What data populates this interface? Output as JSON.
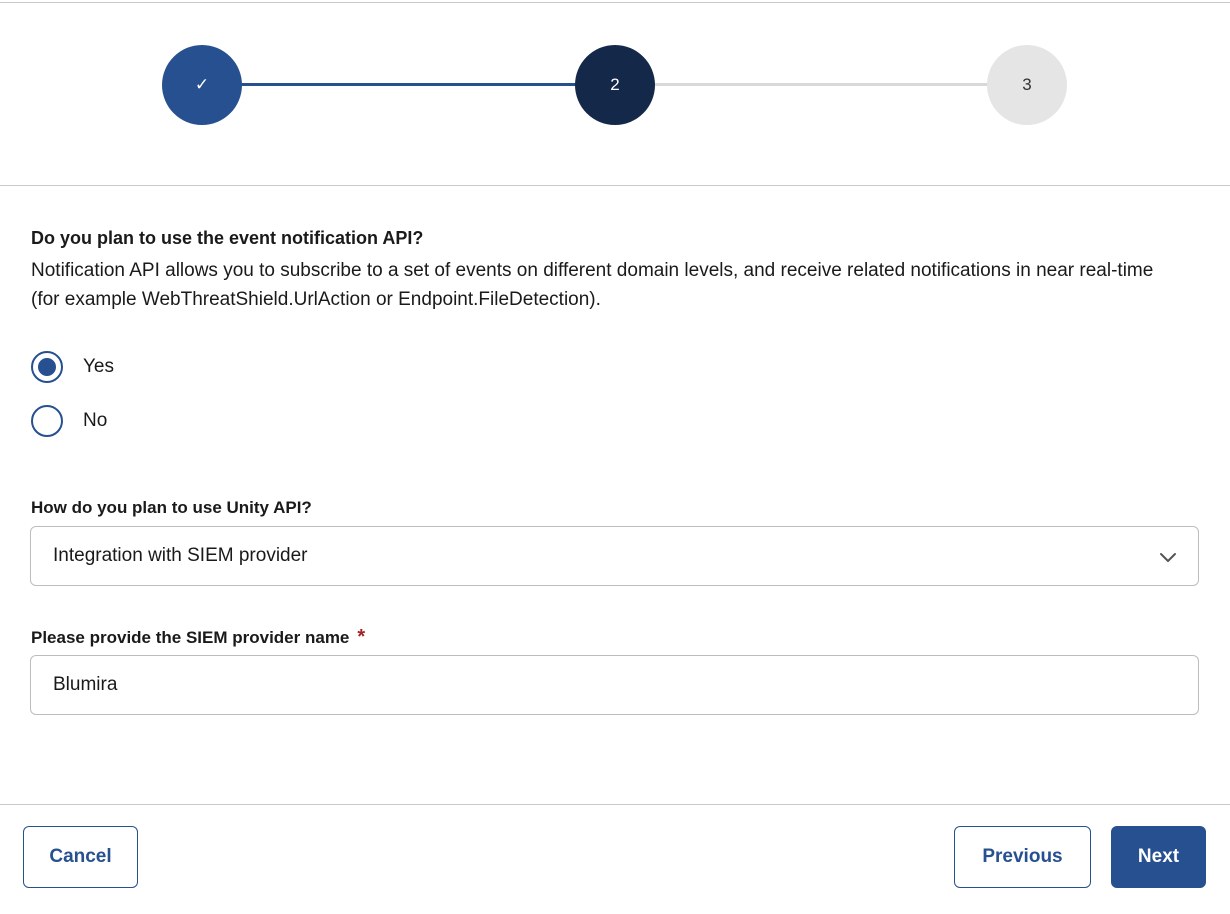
{
  "stepper": {
    "steps": [
      {
        "label": "✓",
        "state": "completed"
      },
      {
        "label": "2",
        "state": "current"
      },
      {
        "label": "3",
        "state": "upcoming"
      }
    ]
  },
  "question": {
    "title": "Do you plan to use the event notification API?",
    "description": "Notification API allows you to subscribe to a set of events on different domain levels, and receive related notifications in near real-time (for example WebThreatShield.UrlAction or Endpoint.FileDetection).",
    "options": [
      {
        "label": "Yes",
        "selected": true
      },
      {
        "label": "No",
        "selected": false
      }
    ]
  },
  "usage": {
    "label": "How do you plan to use Unity API?",
    "selected_value": "Integration with SIEM provider"
  },
  "siem": {
    "label": "Please provide the SIEM provider name",
    "required_marker": "*",
    "value": "Blumira"
  },
  "footer": {
    "cancel_label": "Cancel",
    "previous_label": "Previous",
    "next_label": "Next"
  },
  "colors": {
    "primary": "#26508f",
    "current_step": "#14284a",
    "upcoming_step": "#e5e5e5",
    "required": "#a42222"
  }
}
